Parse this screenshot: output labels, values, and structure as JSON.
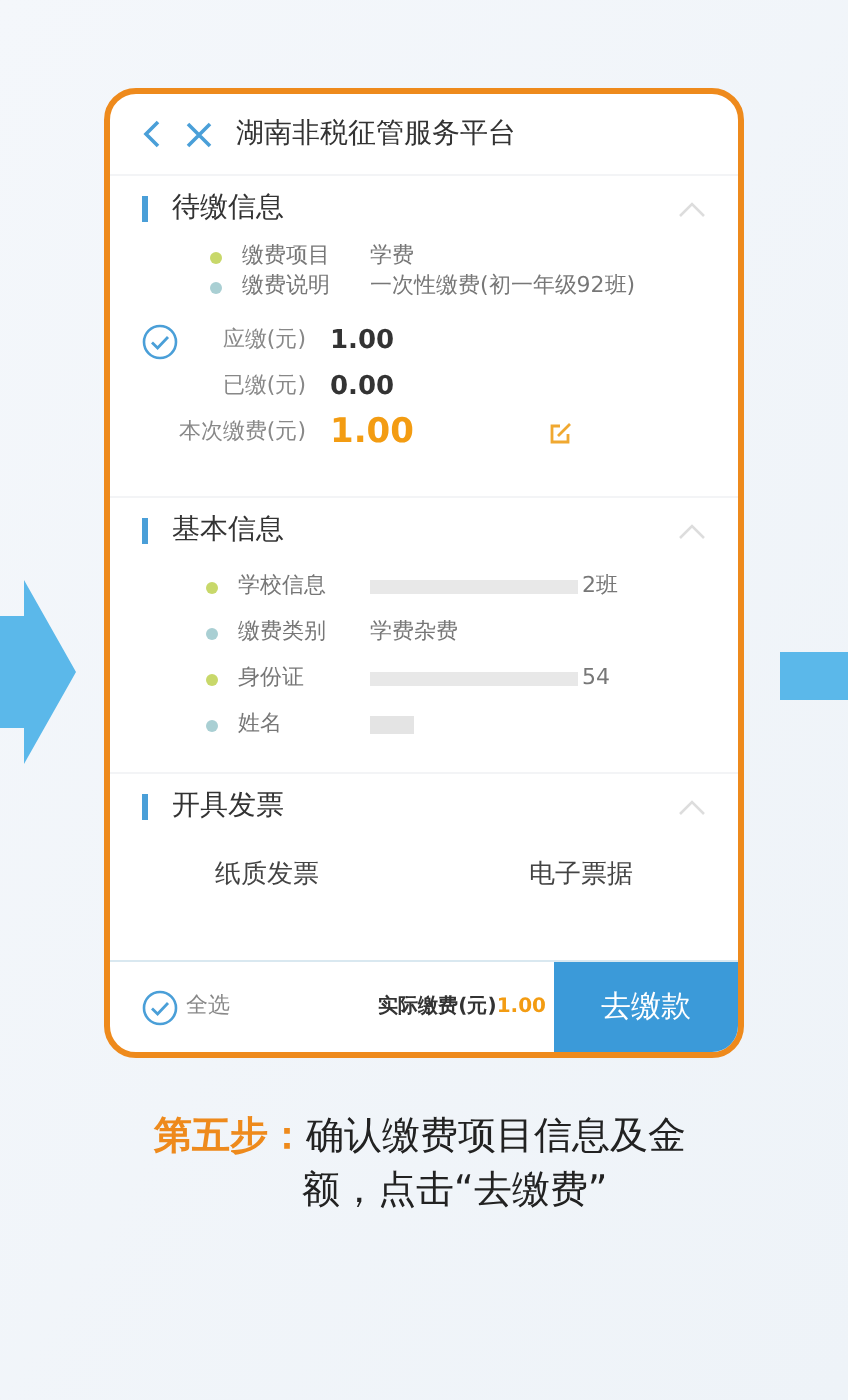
{
  "header": {
    "title": "湖南非税征管服务平台"
  },
  "pending": {
    "title": "待缴信息",
    "expanded": true,
    "items": [
      {
        "label": "缴费项目",
        "value": "学费",
        "color": "#c8d86a"
      },
      {
        "label": "缴费说明",
        "value": "一次性缴费(初一年级92班)",
        "color": "#a9cfd3"
      }
    ],
    "amounts": [
      {
        "label": "应缴(元)",
        "value": "1.00",
        "kind": "plain"
      },
      {
        "label": "已缴(元)",
        "value": "0.00",
        "kind": "plain"
      },
      {
        "label": "本次缴费(元)",
        "value": "1.00",
        "kind": "editable"
      }
    ],
    "checked": true
  },
  "basic": {
    "title": "基本信息",
    "expanded": true,
    "items": [
      {
        "label": "学校信息",
        "value": "2班",
        "masked": true,
        "color": "#c8d86a"
      },
      {
        "label": "缴费类别",
        "value": "学费杂费",
        "masked": false,
        "color": "#a9cfd3"
      },
      {
        "label": "身份证",
        "value": "54",
        "masked": true,
        "color": "#c8d86a"
      },
      {
        "label": "姓名",
        "value": "",
        "masked": true,
        "color": "#a9cfd3"
      }
    ]
  },
  "invoice": {
    "title": "开具发票",
    "expanded": true,
    "options": [
      {
        "label": "纸质发票",
        "selected": false
      },
      {
        "label": "电子票据",
        "selected": false
      }
    ]
  },
  "footer": {
    "select_all": "全选",
    "select_all_checked": true,
    "total_label": "实际缴费(元)",
    "total": "1.00",
    "pay_button": "去缴款"
  },
  "caption": {
    "step": "第五步：",
    "text": "确认缴费项目信息及金额，点击“去缴费”"
  }
}
